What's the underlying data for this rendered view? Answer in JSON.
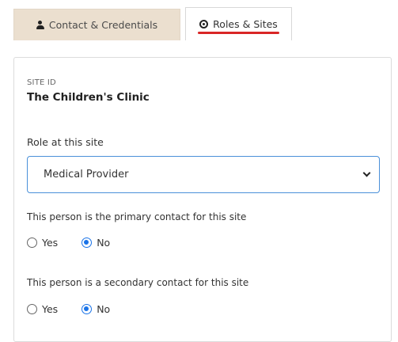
{
  "tabs": [
    {
      "label": "Contact & Credentials",
      "icon": "user-icon",
      "active": false
    },
    {
      "label": "Roles & Sites",
      "icon": "target-icon",
      "active": true
    }
  ],
  "site": {
    "id_label": "SITE ID",
    "name": "The Children's Clinic"
  },
  "role": {
    "label": "Role at this site",
    "selected": "Medical Provider"
  },
  "primary_contact": {
    "question": "This person is the primary contact for this site",
    "options": [
      "Yes",
      "No"
    ],
    "selected": "No"
  },
  "secondary_contact": {
    "question": "This person is a secondary contact for this site",
    "options": [
      "Yes",
      "No"
    ],
    "selected": "No"
  },
  "colors": {
    "inactive_tab": "#ebdfcf",
    "active_underline": "#d92626",
    "focus_border": "#4a90d9",
    "radio_checked": "#1a73e8"
  }
}
